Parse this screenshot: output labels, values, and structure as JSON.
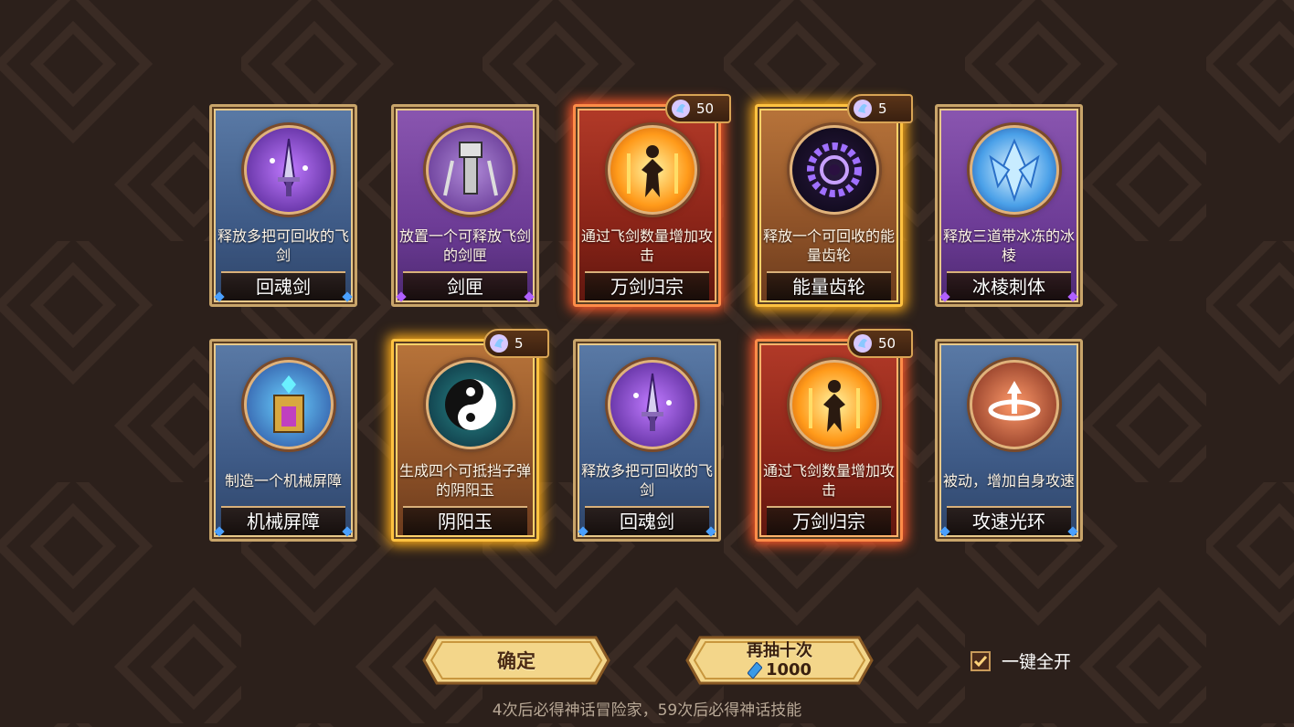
{
  "cards": [
    {
      "theme": "blue",
      "glow": "",
      "icon": "sword-spirit-icon",
      "description": "释放多把可回收的飞剑",
      "name": "回魂剑",
      "badge": null
    },
    {
      "theme": "purple",
      "glow": "",
      "icon": "sword-box-icon",
      "description": "放置一个可释放飞剑的剑匣",
      "name": "剑匣",
      "badge": null
    },
    {
      "theme": "red",
      "glow": "glow-red",
      "icon": "ten-thousand-swords-icon",
      "description": "通过飞剑数量增加攻击",
      "name": "万剑归宗",
      "badge": "50"
    },
    {
      "theme": "orange",
      "glow": "glow-orange",
      "icon": "energy-gear-icon",
      "description": "释放一个可回收的能量齿轮",
      "name": "能量齿轮",
      "badge": "5"
    },
    {
      "theme": "purple",
      "glow": "",
      "icon": "ice-shard-icon",
      "description": "释放三道带冰冻的冰棱",
      "name": "冰棱刺体",
      "badge": null
    },
    {
      "theme": "blue",
      "glow": "",
      "icon": "mech-barrier-icon",
      "description": "制造一个机械屏障",
      "name": "机械屏障",
      "badge": null
    },
    {
      "theme": "orange",
      "glow": "glow-orange",
      "icon": "yin-yang-icon",
      "description": "生成四个可抵挡子弹的阴阳玉",
      "name": "阴阳玉",
      "badge": "5"
    },
    {
      "theme": "blue",
      "glow": "",
      "icon": "sword-spirit-icon",
      "description": "释放多把可回收的飞剑",
      "name": "回魂剑",
      "badge": null
    },
    {
      "theme": "red",
      "glow": "glow-red",
      "icon": "ten-thousand-swords-icon",
      "description": "通过飞剑数量增加攻击",
      "name": "万剑归宗",
      "badge": "50"
    },
    {
      "theme": "blue",
      "glow": "",
      "icon": "attack-speed-ring-icon",
      "description": "被动，增加自身攻速",
      "name": "攻速光环",
      "badge": null
    }
  ],
  "buttons": {
    "confirm_label": "确定",
    "redraw_label": "再抽十次",
    "redraw_cost": "1000"
  },
  "auto_open": {
    "label": "一键全开",
    "checked": true
  },
  "footer_note": "4次后必得神话冒险家，59次后必得神话技能",
  "colors": {
    "background": "#2c201b",
    "gold_frame": "#c9a56a",
    "red_glow": "#ff5a2a",
    "orange_glow": "#ffae1a"
  }
}
